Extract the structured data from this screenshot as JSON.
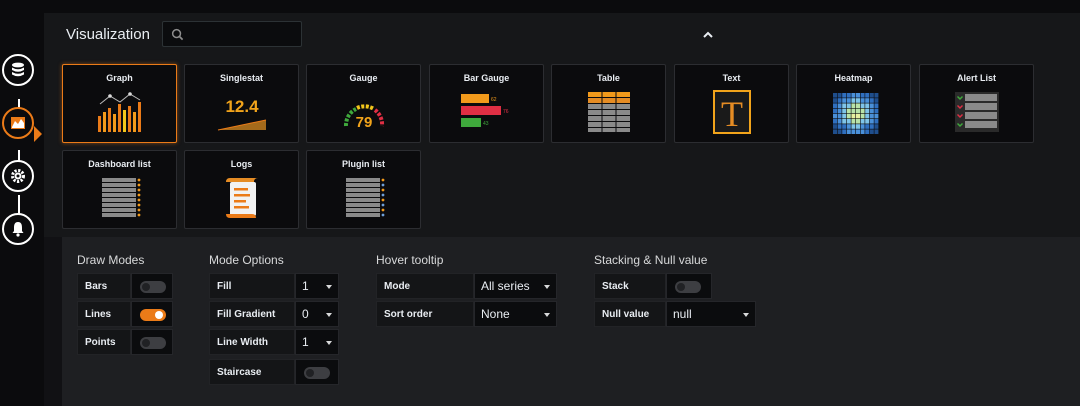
{
  "visualization": {
    "title": "Visualization",
    "search_placeholder": "",
    "types": [
      {
        "label": "Graph",
        "selected": true
      },
      {
        "label": "Singlestat",
        "value": "12.4"
      },
      {
        "label": "Gauge",
        "value": "79"
      },
      {
        "label": "Bar Gauge",
        "bars": [
          "62",
          "76",
          "43"
        ]
      },
      {
        "label": "Table"
      },
      {
        "label": "Text",
        "glyph": "T"
      },
      {
        "label": "Heatmap"
      },
      {
        "label": "Alert List"
      },
      {
        "label": "Dashboard list"
      },
      {
        "label": "Logs"
      },
      {
        "label": "Plugin list"
      }
    ]
  },
  "sidebar": {
    "items": [
      {
        "icon": "database-icon"
      },
      {
        "icon": "visualization-icon",
        "active": true
      },
      {
        "icon": "gear-icon"
      },
      {
        "icon": "bell-icon"
      }
    ]
  },
  "draw_modes": {
    "title": "Draw Modes",
    "bars": {
      "label": "Bars",
      "on": false
    },
    "lines": {
      "label": "Lines",
      "on": true
    },
    "points": {
      "label": "Points",
      "on": false
    }
  },
  "mode_options": {
    "title": "Mode Options",
    "fill": {
      "label": "Fill",
      "value": "1"
    },
    "fill_gradient": {
      "label": "Fill Gradient",
      "value": "0"
    },
    "line_width": {
      "label": "Line Width",
      "value": "1"
    },
    "staircase": {
      "label": "Staircase",
      "on": false
    }
  },
  "hover_tooltip": {
    "title": "Hover tooltip",
    "mode": {
      "label": "Mode",
      "value": "All series"
    },
    "sort_order": {
      "label": "Sort order",
      "value": "None"
    }
  },
  "stacking": {
    "title": "Stacking & Null value",
    "stack": {
      "label": "Stack",
      "on": false
    },
    "null_value": {
      "label": "Null value",
      "value": "null"
    }
  },
  "colors": {
    "accent": "#eb7b18",
    "background": "#111114",
    "panel": "#161719",
    "options_bg": "#1e1f22"
  }
}
